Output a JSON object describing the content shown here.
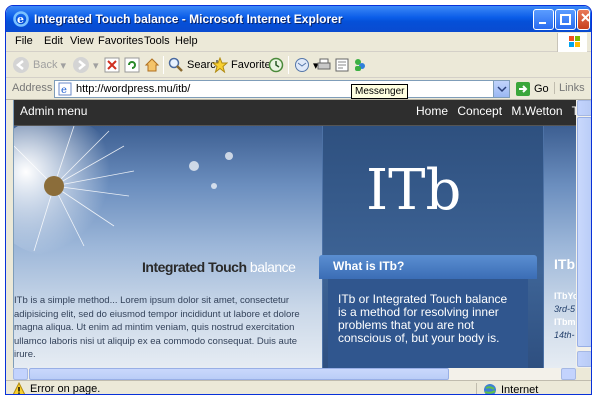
{
  "window": {
    "title": "Integrated Touch balance - Microsoft Internet Explorer"
  },
  "menu": {
    "items": [
      "File",
      "Edit",
      "View",
      "Favorites",
      "Tools",
      "Help"
    ]
  },
  "toolbar": {
    "back_label": "Back",
    "search_label": "Search",
    "favorites_label": "Favorites"
  },
  "address": {
    "label": "Address",
    "url": "http://wordpress.mu/itb/",
    "go_label": "Go",
    "links_label": "Links"
  },
  "tooltip": "Messenger",
  "status": {
    "text": "Error on page.",
    "zone": "Internet"
  },
  "site": {
    "admin_menu": "Admin menu",
    "nav": [
      "Home",
      "Concept",
      "M.Wetton",
      "T"
    ],
    "logo_text": "ITb",
    "brand_dark": "Integrated Touch",
    "brand_light": "balance",
    "intro_text": "ITb is a simple method... Lorem ipsum dolor sit amet, consectetur adipisicing elit, sed do eiusmod tempor incididunt ut labore et dolore magna aliqua. Ut enim ad mintim veniam, quis nostrud exercitation ullamco laboris nisi ut aliquip ex ea commodo consequat. Duis aute irure.",
    "what_title": "What is ITb?",
    "what_text": "ITb or Integrated Touch balance is a method for resolving inner problems that you are not conscious of, but your body is.",
    "right_heading": "ITb",
    "right_lines": [
      "ITbYo",
      "3rd-5",
      "ITbm",
      "14th-"
    ]
  },
  "colors": {
    "titlebar": "#0a5ce8",
    "nav_bg": "#2e2e2e",
    "panel_blue": "#30568e",
    "tab_blue": "#4a7ec4"
  }
}
